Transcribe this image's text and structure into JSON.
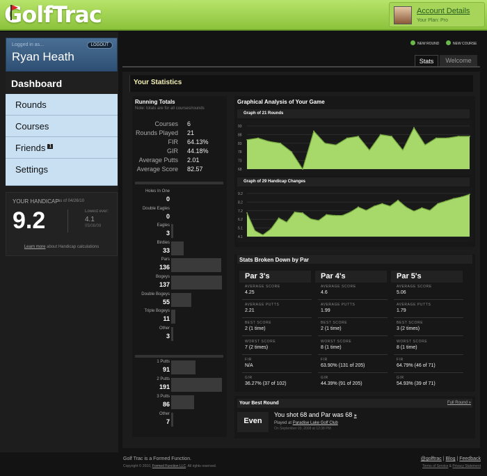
{
  "header": {
    "logo": "GolfTrac",
    "account_label": "Account Details",
    "plan": "Your Plan: Pro"
  },
  "user": {
    "logged_in_label": "Logged in as...",
    "logout": "LOGOUT",
    "name": "Ryan Heath"
  },
  "nav": {
    "active": "Dashboard",
    "items": [
      "Rounds",
      "Courses",
      "Friends",
      "Settings"
    ],
    "friends_badge": "1"
  },
  "handicap": {
    "title": "YOUR HANDICAP",
    "as_of": "as of 04/26/10",
    "value": "9.2",
    "lowest_label": "Lowest ever:",
    "lowest_value": "4.1",
    "lowest_date": "05/08/09",
    "learn_more": "Learn more",
    "learn_rest": " about Handicap calculations"
  },
  "actions": {
    "new_round": "NEW ROUND",
    "new_course": "NEW COURSE"
  },
  "tabs": {
    "active": "Stats",
    "other": "Welcome"
  },
  "stats_title": "Your Statistics",
  "running_totals": {
    "title": "Running Totals",
    "note": "Note: totals are for all courses/rounds",
    "rows": [
      {
        "k": "Courses",
        "v": "6"
      },
      {
        "k": "Rounds Played",
        "v": "21"
      },
      {
        "k": "FIR",
        "v": "64.13%"
      },
      {
        "k": "GIR",
        "v": "44.18%"
      },
      {
        "k": "Average Putts",
        "v": "2.01"
      },
      {
        "k": "Average Score",
        "v": "82.57"
      }
    ]
  },
  "hole_stats": [
    {
      "k": "Holes In One",
      "v": "0",
      "frac": 0
    },
    {
      "k": "Double Eagles",
      "v": "0",
      "frac": 0
    },
    {
      "k": "Eagles",
      "v": "3",
      "frac": 0.02
    },
    {
      "k": "Birdies",
      "v": "33",
      "frac": 0.24
    },
    {
      "k": "Pars",
      "v": "136",
      "frac": 0.99
    },
    {
      "k": "Bogeys",
      "v": "137",
      "frac": 1
    },
    {
      "k": "Double Bogeys",
      "v": "55",
      "frac": 0.4
    },
    {
      "k": "Triple Bogeys",
      "v": "11",
      "frac": 0.08
    },
    {
      "k": "Other",
      "v": "3",
      "frac": 0.02
    }
  ],
  "putt_stats": [
    {
      "k": "1 Putts",
      "v": "91",
      "frac": 0.48
    },
    {
      "k": "2 Putts",
      "v": "191",
      "frac": 1
    },
    {
      "k": "3 Putts",
      "v": "86",
      "frac": 0.45
    },
    {
      "k": "Other",
      "v": "7",
      "frac": 0.04
    }
  ],
  "graph": {
    "title": "Graphical Analysis of Your Game",
    "g1_title": "Graph of 21 Rounds",
    "g2_title": "Graph of 29 Handicap Changes"
  },
  "chart_data": [
    {
      "type": "area",
      "title": "Graph of 21 Rounds",
      "yticks": [
        "93",
        "88",
        "83",
        "78",
        "73",
        "68"
      ],
      "ylim": [
        68,
        93
      ],
      "values": [
        85,
        86,
        84,
        83,
        78,
        68,
        90,
        83,
        82,
        86,
        87,
        79,
        88,
        87,
        79,
        92,
        82,
        86,
        86,
        87,
        87
      ]
    },
    {
      "type": "area",
      "title": "Graph of 29 Handicap Changes",
      "yticks": [
        "9.2",
        "8.2",
        "7.2",
        "6.2",
        "5.1",
        "4.1"
      ],
      "ylim": [
        4.1,
        9.2
      ],
      "values": [
        6.9,
        4.8,
        4.3,
        5.0,
        6.3,
        5.8,
        7.0,
        6.9,
        6.2,
        6.0,
        6.7,
        6.6,
        6.6,
        7.0,
        7.6,
        7.2,
        7.7,
        8.0,
        7.7,
        8.4,
        7.6,
        7.1,
        7.5,
        7.2,
        8.0,
        8.3,
        8.6,
        8.8,
        9.1
      ]
    }
  ],
  "par": {
    "title": "Stats Broken Down by Par",
    "labels": {
      "avg_score": "AVERAGE SCORE",
      "avg_putts": "AVERAGE PUTTS",
      "best": "BEST SCORE",
      "worst": "WORST SCORE",
      "fir": "FIR",
      "gir": "GIR"
    },
    "cols": [
      {
        "h": "Par 3's",
        "avg_score": "4.25",
        "avg_putts": "2.21",
        "best": "2  (1 time)",
        "worst": "7  (2 times)",
        "fir": "N/A",
        "gir": "36.27%  (37 of 102)"
      },
      {
        "h": "Par 4's",
        "avg_score": "4.6",
        "avg_putts": "1.99",
        "best": "2  (1 time)",
        "worst": "8  (1 time)",
        "fir": "63.90%  (131 of 205)",
        "gir": "44.39%  (91 of 205)"
      },
      {
        "h": "Par 5's",
        "avg_score": "5.06",
        "avg_putts": "1.79",
        "best": "3  (2 times)",
        "worst": "8  (1 time)",
        "fir": "64.79%  (46 of 71)",
        "gir": "54.93%  (39 of 71)"
      }
    ]
  },
  "best_round": {
    "title": "Your Best Round",
    "full": "Full Round »",
    "badge": "Even",
    "shot_text": "You shot 68 and Par was 68 ",
    "shot_link": "»",
    "played_at": "Played at ",
    "course": "Paradise Lake Golf Club",
    "when": "On September 03, 2008 at 12:38 PM"
  },
  "footer": {
    "line1": "Golf Trac is a Formed Function.",
    "copy": "Copyright © 2010, ",
    "company": "Formed Function LLC",
    "rights": ". All rights reserved.",
    "links": [
      "@golftrac",
      "Blog",
      "Feedback"
    ],
    "legal": [
      "Terms of Service",
      "Privacy Statement"
    ]
  },
  "colors": {
    "accent": "#a6d96a",
    "header": "#9ccf4e",
    "nav": "#c9e0f3"
  }
}
